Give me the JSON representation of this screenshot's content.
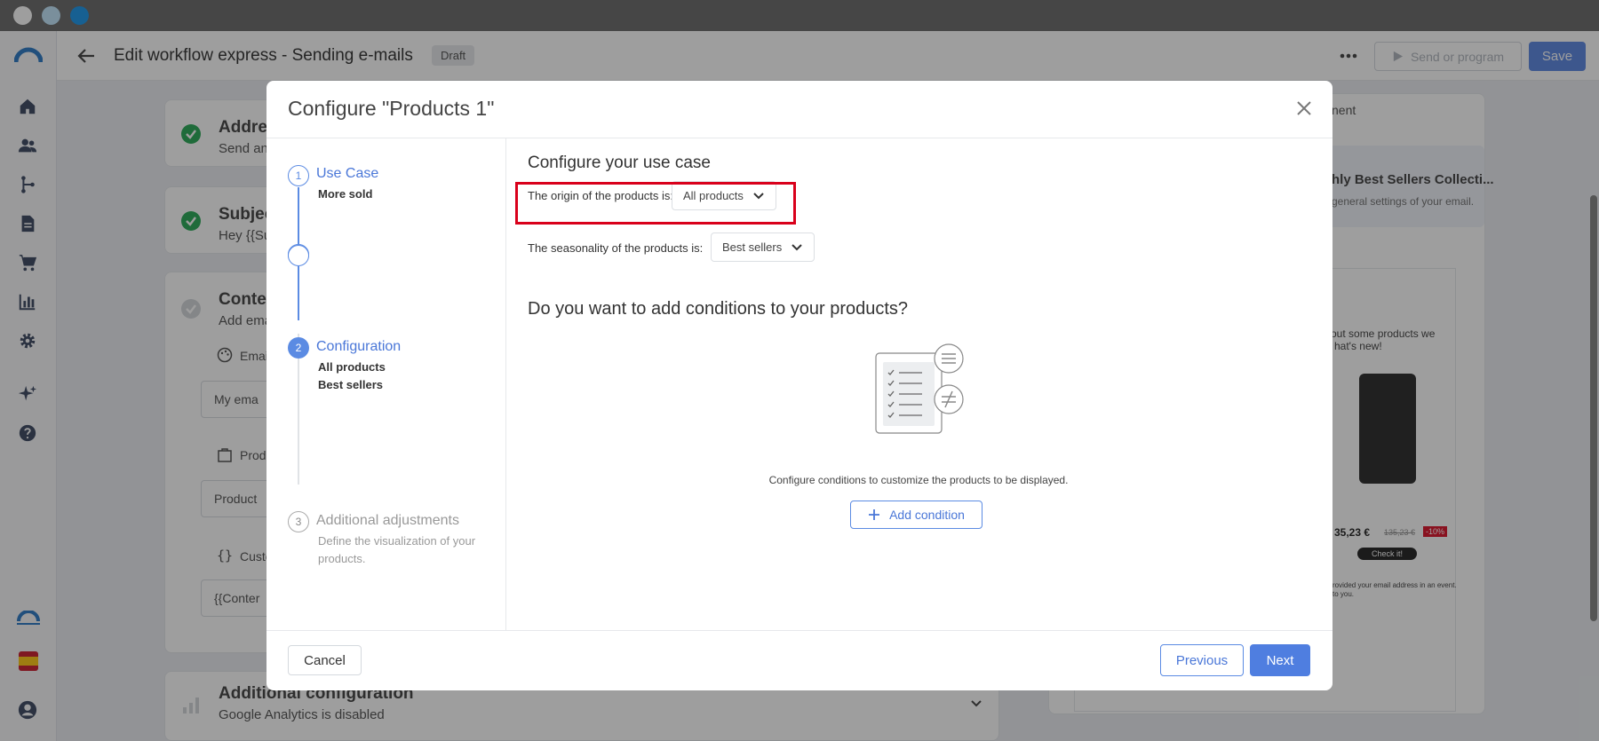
{
  "colors": {
    "accent": "#4f7ee0",
    "success": "#19a34a",
    "highlight": "#d9001b"
  },
  "sidebar": {
    "logo_icon": "brand-arc-icon",
    "items": [
      {
        "name": "home-icon"
      },
      {
        "name": "contacts-icon"
      },
      {
        "name": "workflow-icon"
      },
      {
        "name": "document-icon"
      },
      {
        "name": "cart-icon"
      },
      {
        "name": "chart-icon"
      },
      {
        "name": "gear-icon"
      },
      {
        "name": "sparkle-icon"
      },
      {
        "name": "help-icon"
      }
    ],
    "bottom": {
      "language_flag": "spain-flag-icon",
      "user": "user-icon"
    }
  },
  "header": {
    "title": "Edit workflow express - Sending e-mails",
    "status": "Draft",
    "send_label": "Send or program",
    "save_label": "Save"
  },
  "background": {
    "address": {
      "title": "Addres",
      "sub": "Send an"
    },
    "subject": {
      "title": "Subjec",
      "sub": "Hey {{Su"
    },
    "content": {
      "title": "Conten",
      "sub": "Add ema",
      "email_label": "Emai",
      "email_value": "My ema",
      "product_label": "Prod",
      "product_value": "Product",
      "custom_label": "Custo",
      "custom_value": "{{Conter"
    },
    "additional": {
      "title": "Additional configuration",
      "sub": "Google Analytics is disabled"
    },
    "right_tab": "nent",
    "right_card": {
      "title": "hly Best Sellers Collecti...",
      "sub": "general settings of your email."
    },
    "preview": {
      "text1": "out some products we",
      "text2": "hat's new!",
      "price": "35,23 €",
      "old_price": "135,23 €",
      "discount": "-10%",
      "cta": "Check it!",
      "footer": "rovided your email address in an event.",
      "footer2": "to you."
    }
  },
  "modal": {
    "title": "Configure \"Products 1\"",
    "steps": [
      {
        "num": "1",
        "name": "Use Case",
        "sub": [
          "More sold"
        ]
      },
      {
        "num": "2",
        "name": "Configuration",
        "sub": [
          "All products",
          "Best sellers"
        ]
      },
      {
        "num": "3",
        "name": "Additional adjustments",
        "sub": [
          "Define the visualization of your",
          "products."
        ]
      }
    ],
    "section_title": "Configure your use case",
    "origin": {
      "label": "The origin of the products is:",
      "value": "All products"
    },
    "seasonality": {
      "label": "The seasonality of the products is:",
      "value": "Best sellers"
    },
    "conditions_title": "Do you want to add conditions to your products?",
    "conditions_hint": "Configure conditions to customize the products to be displayed.",
    "add_condition": "Add condition",
    "cancel": "Cancel",
    "previous": "Previous",
    "next": "Next"
  }
}
